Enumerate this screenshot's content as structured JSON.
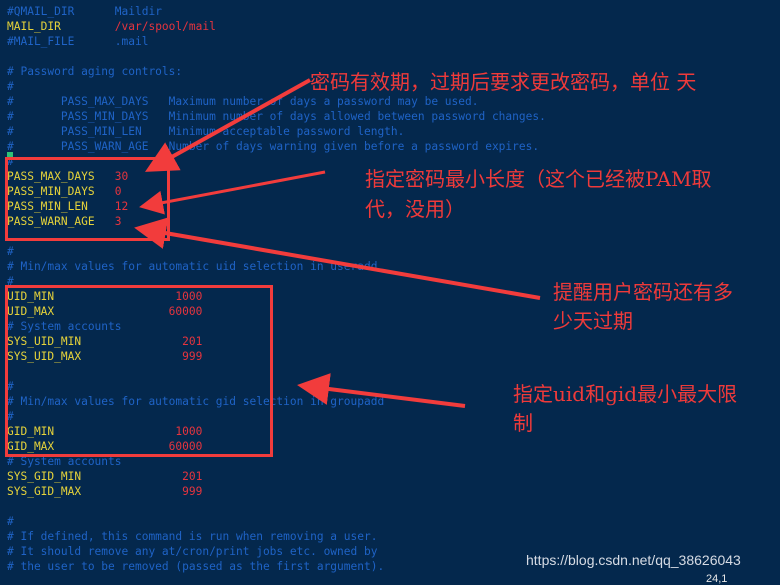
{
  "editor": {
    "lines": [
      {
        "key": "#QMAIL_DIR",
        "value": "Maildir",
        "type": "comment-kv"
      },
      {
        "key": "MAIL_DIR",
        "value": "/var/spool/mail",
        "type": "kv"
      },
      {
        "key": "#MAIL_FILE",
        "value": ".mail",
        "type": "comment-kv"
      },
      {
        "text": "",
        "type": "blank"
      },
      {
        "text": "# Password aging controls:",
        "type": "comment"
      },
      {
        "text": "#",
        "type": "comment"
      },
      {
        "text": "#\tPASS_MAX_DAYS\tMaximum number of days a password may be used.",
        "type": "comment"
      },
      {
        "text": "#\tPASS_MIN_DAYS\tMinimum number of days allowed between password changes.",
        "type": "comment"
      },
      {
        "text": "#\tPASS_MIN_LEN\tMinimum acceptable password length.",
        "type": "comment"
      },
      {
        "text": "#\tPASS_WARN_AGE\tNumber of days warning given before a password expires.",
        "type": "comment"
      },
      {
        "text": "#",
        "type": "comment"
      },
      {
        "key": "PASS_MAX_DAYS",
        "value": "30",
        "type": "kv"
      },
      {
        "key": "PASS_MIN_DAYS",
        "value": "0",
        "type": "kv"
      },
      {
        "key": "PASS_MIN_LEN",
        "value": "12",
        "type": "kv"
      },
      {
        "key": "PASS_WARN_AGE",
        "value": "3",
        "type": "kv"
      },
      {
        "text": "",
        "type": "blank"
      },
      {
        "text": "#",
        "type": "comment"
      },
      {
        "text": "# Min/max values for automatic uid selection in useradd",
        "type": "comment"
      },
      {
        "text": "#",
        "type": "comment"
      },
      {
        "key": "UID_MIN",
        "value": "1000",
        "type": "kv-right"
      },
      {
        "key": "UID_MAX",
        "value": "60000",
        "type": "kv-right"
      },
      {
        "text": "# System accounts",
        "type": "comment"
      },
      {
        "key": "SYS_UID_MIN",
        "value": "201",
        "type": "kv-right"
      },
      {
        "key": "SYS_UID_MAX",
        "value": "999",
        "type": "kv-right"
      },
      {
        "text": "",
        "type": "blank"
      },
      {
        "text": "#",
        "type": "comment"
      },
      {
        "text": "# Min/max values for automatic gid selection in groupadd",
        "type": "comment"
      },
      {
        "text": "#",
        "type": "comment"
      },
      {
        "key": "GID_MIN",
        "value": "1000",
        "type": "kv-right"
      },
      {
        "key": "GID_MAX",
        "value": "60000",
        "type": "kv-right"
      },
      {
        "text": "# System accounts",
        "type": "comment"
      },
      {
        "key": "SYS_GID_MIN",
        "value": "201",
        "type": "kv-right"
      },
      {
        "key": "SYS_GID_MAX",
        "value": "999",
        "type": "kv-right"
      },
      {
        "text": "",
        "type": "blank"
      },
      {
        "text": "#",
        "type": "comment"
      },
      {
        "text": "# If defined, this command is run when removing a user.",
        "type": "comment"
      },
      {
        "text": "# It should remove any at/cron/print jobs etc. owned by",
        "type": "comment"
      },
      {
        "text": "# the user to be removed (passed as the first argument).",
        "type": "comment"
      }
    ],
    "status_position": "24,1"
  },
  "annotations": {
    "max_days": "密码有效期，过期后要求更改密码，单位 天",
    "min_len_line1": "指定密码最小长度（这个已经被PAM取",
    "min_len_line2": "代，没用）",
    "warn_age_line1": "提醒用户密码还有多",
    "warn_age_line2": "少天过期",
    "uid_gid_line1": "指定uid和gid最小最大限",
    "uid_gid_line2": "制"
  },
  "watermark": "https://blog.csdn.net/qq_38626043",
  "colors": {
    "background": "#04284d",
    "comment": "#1f63c6",
    "key": "#e6d33a",
    "value": "#e5343e",
    "annotation": "#ef3a3a"
  }
}
